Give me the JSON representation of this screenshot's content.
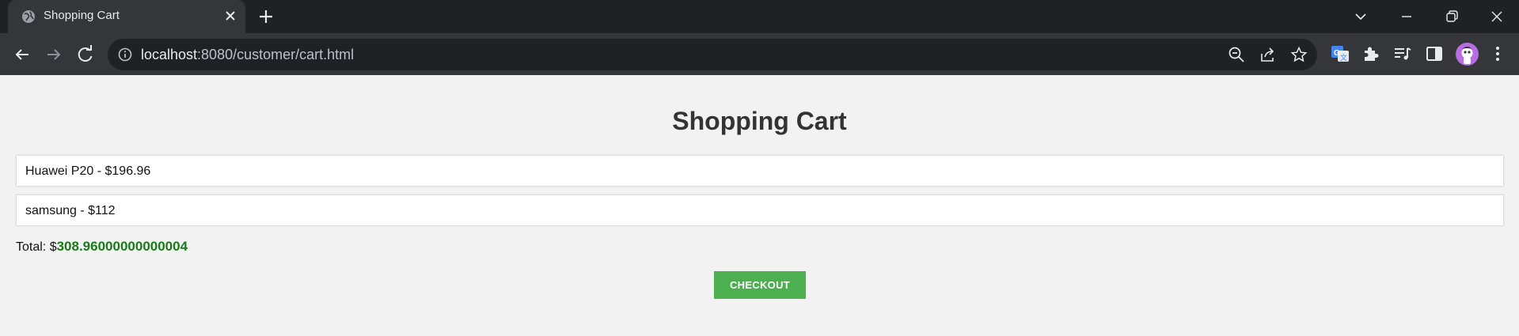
{
  "browser": {
    "tab_title": "Shopping Cart",
    "url_host": "localhost",
    "url_rest": ":8080/customer/cart.html",
    "favicon": "globe-icon"
  },
  "page": {
    "title": "Shopping Cart",
    "items": [
      {
        "text": "Huawei P20 - $196.96"
      },
      {
        "text": "samsung - $112"
      }
    ],
    "total_label": "Total: $",
    "total_value": "308.96000000000004",
    "checkout_label": "CHECKOUT"
  },
  "colors": {
    "page_background": "#f2f2f2",
    "total_value": "#177b17",
    "checkout_button": "#4caf50",
    "title_text": "#333333"
  }
}
